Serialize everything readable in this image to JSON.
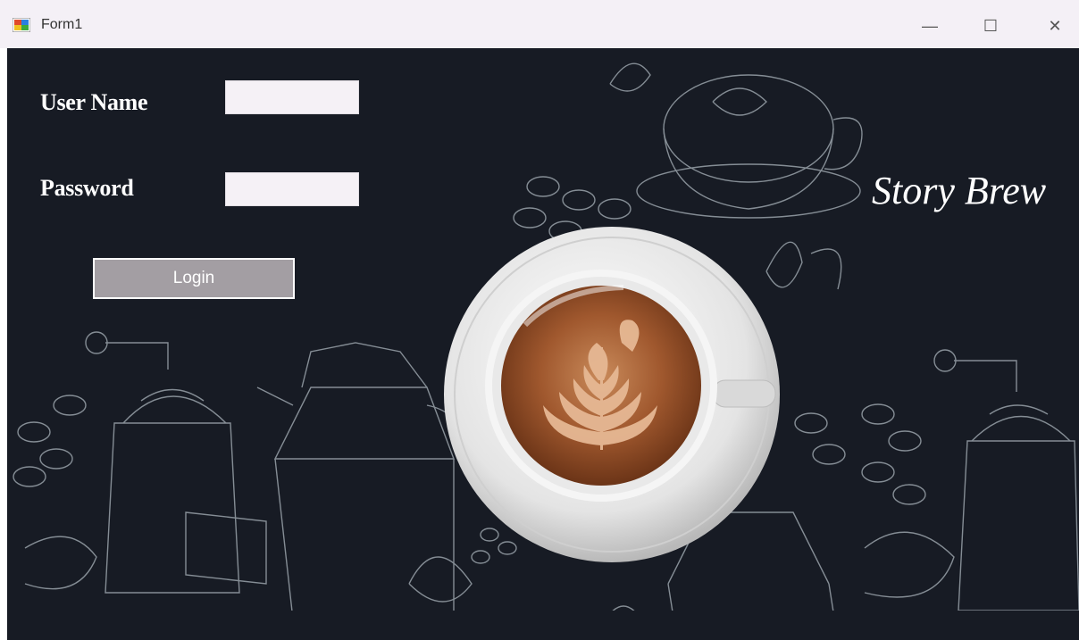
{
  "window": {
    "title": "Form1",
    "controls": {
      "minimize": "—",
      "maximize": "☐",
      "close": "✕"
    }
  },
  "form": {
    "username_label": "User Name",
    "username_value": "",
    "password_label": "Password",
    "password_value": "",
    "login_label": "Login"
  },
  "brand": {
    "name": "Story Brew"
  },
  "colors": {
    "background": "#171b24",
    "titlebar": "#f4f0f6",
    "button": "#a39ea3",
    "input": "#f5f1f6"
  },
  "icons": [
    "app-icon",
    "coffee-cup-image",
    "coffee-sketch-background"
  ]
}
